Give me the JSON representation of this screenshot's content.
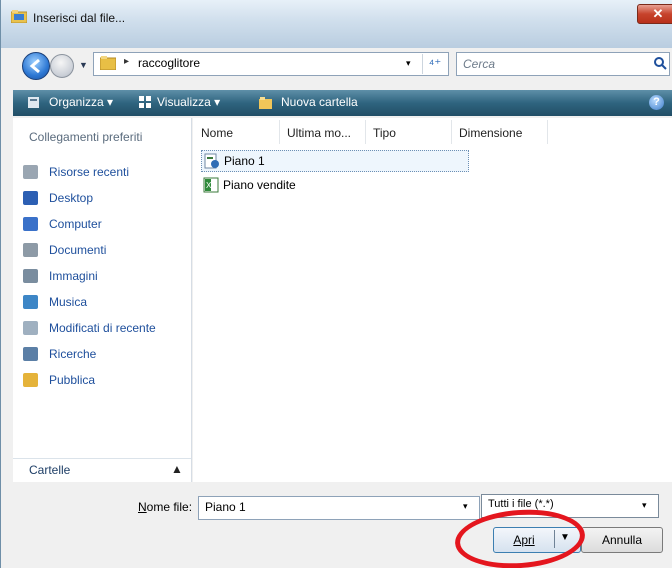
{
  "window": {
    "title": "Inserisci dal file...",
    "close_label": "✕"
  },
  "address": {
    "separator": "▸",
    "path": "raccoglitore",
    "dropdown": "▾",
    "refresh": "⁴⁺"
  },
  "search": {
    "placeholder": "Cerca"
  },
  "toolbar": {
    "organize": "Organizza ▾",
    "views": "Visualizza ▾",
    "new_folder": "Nuova cartella",
    "help": "?"
  },
  "sidebar": {
    "header": "Collegamenti preferiti",
    "items": [
      {
        "label": "Risorse recenti",
        "icon": "recent-icon",
        "color": "#9aa6b2"
      },
      {
        "label": "Desktop",
        "icon": "desktop-icon",
        "color": "#2c5fb3"
      },
      {
        "label": "Computer",
        "icon": "computer-icon",
        "color": "#3a71c9"
      },
      {
        "label": "Documenti",
        "icon": "documents-icon",
        "color": "#8d9aa6"
      },
      {
        "label": "Immagini",
        "icon": "pictures-icon",
        "color": "#7a8d9f"
      },
      {
        "label": "Musica",
        "icon": "music-icon",
        "color": "#3d86c6"
      },
      {
        "label": "Modificati di recente",
        "icon": "recently-changed-icon",
        "color": "#9fb0c0"
      },
      {
        "label": "Ricerche",
        "icon": "searches-icon",
        "color": "#5b7fa6"
      },
      {
        "label": "Pubblica",
        "icon": "public-folder-icon",
        "color": "#e5b33a"
      }
    ],
    "folders_label": "Cartelle",
    "folders_chevron": "▲"
  },
  "columns": [
    "Nome",
    "Ultima mo...",
    "Tipo",
    "Dimensione"
  ],
  "files": [
    {
      "name": "Piano 1",
      "icon": "project-file-icon",
      "selected": true
    },
    {
      "name": "Piano vendite",
      "icon": "excel-file-icon",
      "selected": false
    }
  ],
  "footer": {
    "filename_label_prefix": "N",
    "filename_label_rest": "ome file:",
    "filename_value": "Piano 1",
    "dropdown": "▾",
    "filter_value": "Tutti i file (*.*)",
    "open_label": "Apri",
    "open_arrow": "▼",
    "cancel_label": "Annulla"
  },
  "colors": {
    "toolbar": "#2f647f",
    "link": "#1e4f9c",
    "highlight_ring": "#e4161e"
  }
}
